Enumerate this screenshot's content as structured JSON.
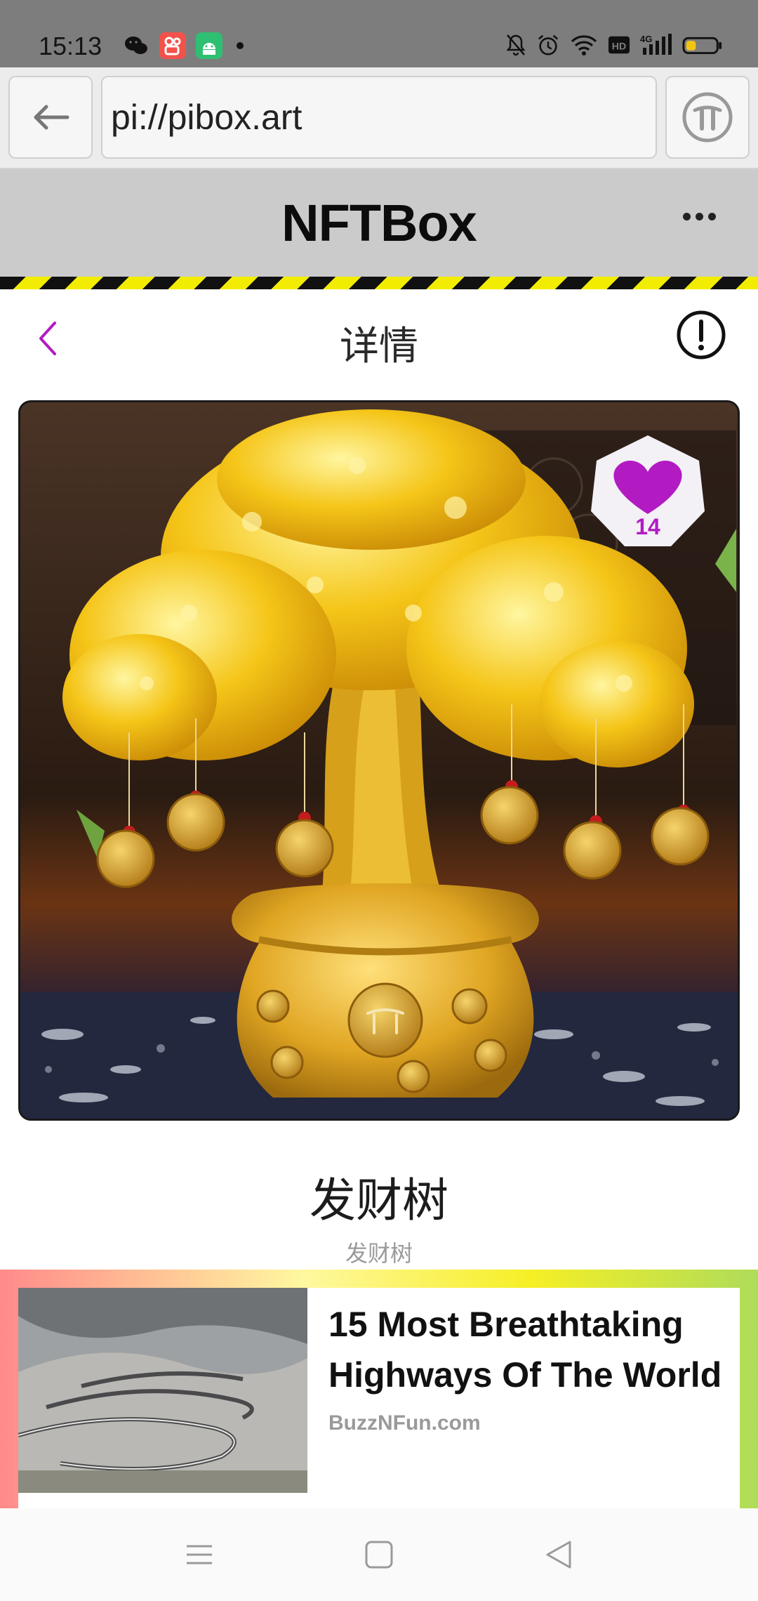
{
  "status_bar": {
    "time": "15:13",
    "apps": [
      "wechat-icon",
      "kuaishou-icon",
      "android-app-icon"
    ],
    "indicators": [
      "mute-icon",
      "alarm-icon",
      "wifi-icon",
      "hd-icon",
      "4g-signal-icon",
      "battery-icon"
    ],
    "network": "4G",
    "hd": "HD"
  },
  "browser": {
    "url": "pi://pibox.art",
    "back_icon": "arrow-left-icon",
    "pi_icon": "pi-logo-icon"
  },
  "app_header": {
    "title": "NFTBox",
    "menu_icon": "more-dots-icon"
  },
  "detail": {
    "title": "详情",
    "back_icon": "chevron-left-icon",
    "info_icon": "exclamation-circle-icon",
    "likes": "14",
    "like_icon": "heart-icon",
    "nft_name": "发财树",
    "nft_subtitle": "发财树"
  },
  "ad": {
    "headline": "15 Most Breathtaking Highways Of The World",
    "source": "BuzzNFun.com"
  },
  "nav": {
    "items": [
      "menu-icon",
      "home-square-icon",
      "back-triangle-icon"
    ]
  },
  "colors": {
    "accent": "#b21bc2",
    "header_bg": "#cbcbcb",
    "hazard_yellow": "#f2ec00"
  }
}
